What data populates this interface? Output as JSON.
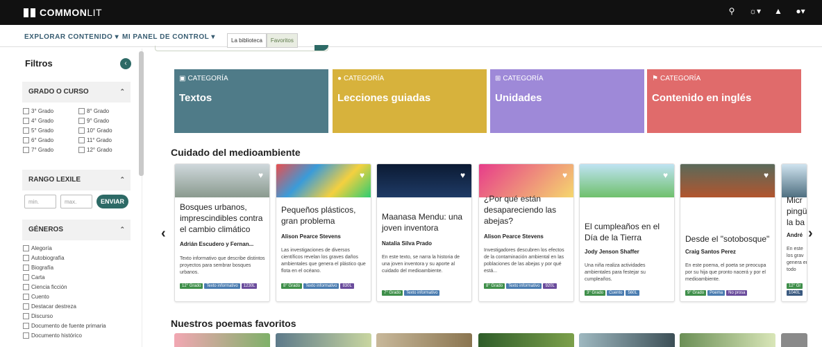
{
  "header": {
    "logo_bold": "COMMON",
    "logo_rest": "LIT",
    "icons": [
      "search-icon",
      "globe-icon",
      "bell-icon",
      "user-icon"
    ]
  },
  "nav": {
    "explore": "EXPLORAR CONTENIDO ▾",
    "dashboard": "MI PANEL DE CONTROL ▾",
    "tab_library": "La biblioteca",
    "tab_favorites": "Favoritos"
  },
  "sidebar": {
    "title": "Filtros",
    "grade_section": "GRADO O CURSO",
    "grades": [
      "3° Grado",
      "8° Grado",
      "4° Grado",
      "9° Grado",
      "5° Grado",
      "10° Grado",
      "6° Grado",
      "11° Grado",
      "7° Grado",
      "12° Grado"
    ],
    "lexile_section": "RANGO LEXILE",
    "lexile_min_placeholder": "min.",
    "lexile_max_placeholder": "max.",
    "lexile_button": "ENVIAR",
    "genres_section": "GÉNEROS",
    "genres": [
      "Alegoría",
      "Autobiografía",
      "Biografía",
      "Carta",
      "Ciencia ficción",
      "Cuento",
      "Destacar destreza",
      "Discurso",
      "Documento de fuente primaria",
      "Documento histórico"
    ]
  },
  "categories": [
    {
      "label": "CATEGORÍA",
      "title": "Textos",
      "color": "#4f7b88"
    },
    {
      "label": "CATEGORÍA",
      "title": "Lecciones guiadas",
      "color": "#d7b23c"
    },
    {
      "label": "CATEGORÍA",
      "title": "Unidades",
      "color": "#9e89d8"
    },
    {
      "label": "CATEGORÍA",
      "title": "Contenido en inglés",
      "color": "#e06b6b"
    }
  ],
  "section_environment": "Cuidado del medioambiente",
  "section_poems": "Nuestros poemas favoritos",
  "cards": [
    {
      "title": "Bosques urbanos, imprescindibles contra el cambio climático",
      "author": "Adrián Escudero y Fernan...",
      "desc": "Texto informativo que describe distintos proyectos para sembrar bosques urbanos.",
      "tags": [
        "12° Grado",
        "Texto informativo",
        "1230L"
      ]
    },
    {
      "title": "Pequeños plásticos, gran problema",
      "author": "Alison Pearce Stevens",
      "desc": "Las investigaciones de diversos científicos revelan los graves daños ambientales que genera el plástico que flota en el océano.",
      "tags": [
        "8° Grado",
        "Texto informativo",
        "830L"
      ]
    },
    {
      "title": "Maanasa Mendu: una joven inventora",
      "author": "Natalia Silva Prado",
      "desc": "En este texto, se narra la historia de una joven inventora y su aporte al cuidado del medioambiente.",
      "tags": [
        "7° Grado",
        "Texto informativo"
      ]
    },
    {
      "title": "¿Por qué están desapareciendo las abejas?",
      "author": "Alison Pearce Stevens",
      "desc": "Investigadores descubren los efectos de la contaminación ambiental en las poblaciones de las abejas y por qué está...",
      "tags": [
        "8° Grado",
        "Texto informativo",
        "920L"
      ]
    },
    {
      "title": "El cumpleaños en el Día de la Tierra",
      "author": "Jody Jenson Shaffer",
      "desc": "Una niña realiza actividades ambientales para festejar su cumpleaños.",
      "tags": [
        "3° Grado",
        "Cuento",
        "560L"
      ]
    },
    {
      "title": "Desde el \"sotobosque\"",
      "author": "Craig Santos Perez",
      "desc": "En este poema, el poeta se preocupa por su hija que pronto nacerá y por el medioambiente.",
      "tags": [
        "9° Grado",
        "Poema",
        "No prosa"
      ]
    },
    {
      "title": "Micr pingü la ba",
      "author": "André",
      "desc": "En este los grav genera en todo",
      "tags": [
        "12° Gr",
        "1040L"
      ]
    }
  ]
}
